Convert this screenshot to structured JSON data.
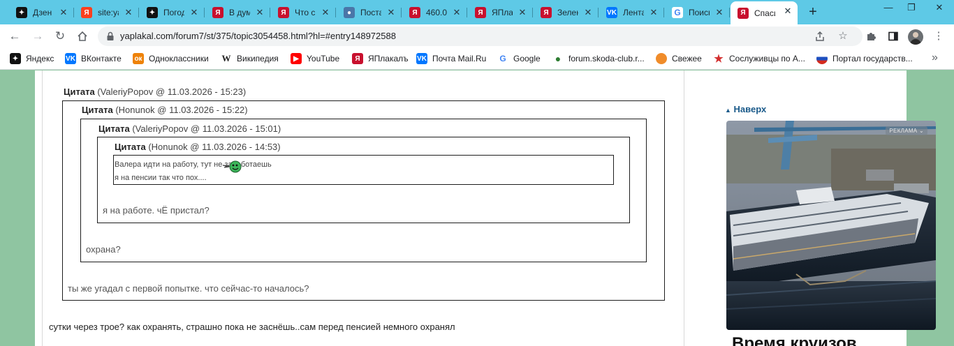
{
  "tabs": [
    {
      "title": "Дзен",
      "icon": "dzen-icon",
      "color": "#111111"
    },
    {
      "title": "site:ya",
      "icon": "yandex-icon",
      "color": "#fc3f1d"
    },
    {
      "title": "Погода",
      "icon": "dzen-icon",
      "color": "#111111"
    },
    {
      "title": "В дум",
      "icon": "yaplakal-icon",
      "color": "#c8102e"
    },
    {
      "title": "Что с",
      "icon": "yaplakal-icon",
      "color": "#c8102e"
    },
    {
      "title": "Поста",
      "icon": "site-icon",
      "color": "#4a76a8"
    },
    {
      "title": "460.0",
      "icon": "yaplakal-icon",
      "color": "#c8102e"
    },
    {
      "title": "ЯПлак",
      "icon": "yaplakal-icon",
      "color": "#c8102e"
    },
    {
      "title": "Зелен",
      "icon": "yaplakal-icon",
      "color": "#c8102e"
    },
    {
      "title": "Лента",
      "icon": "vk-icon",
      "color": "#0077ff"
    },
    {
      "title": "Поиск",
      "icon": "google-icon",
      "color": "#ffffff"
    },
    {
      "title": "Спаси",
      "icon": "yaplakal-icon",
      "color": "#c8102e",
      "active": true
    }
  ],
  "address_bar": {
    "url": "yaplakal.com/forum7/st/375/topic3054458.html?hl=#entry148972588"
  },
  "bookmarks": [
    {
      "label": "Яндекс",
      "icon": "dzen-icon",
      "color": "#111111"
    },
    {
      "label": "ВКонтакте",
      "icon": "vk-icon",
      "color": "#0077ff"
    },
    {
      "label": "Одноклассники",
      "icon": "ok-icon",
      "color": "#ee8208"
    },
    {
      "label": "Википедия",
      "icon": "wikipedia-icon",
      "color": "#ffffff"
    },
    {
      "label": "YouTube",
      "icon": "youtube-icon",
      "color": "#ff0000"
    },
    {
      "label": "ЯПлакалъ",
      "icon": "yaplakal-icon",
      "color": "#c8102e"
    },
    {
      "label": "Почта Mail.Ru",
      "icon": "vk-icon",
      "color": "#0077ff"
    },
    {
      "label": "Google",
      "icon": "google-icon",
      "color": "#ffffff"
    },
    {
      "label": "forum.skoda-club.r...",
      "icon": "skoda-icon",
      "color": "#ffffff"
    },
    {
      "label": "Свежее",
      "icon": "pikabu-icon",
      "color": "#f08c2a"
    },
    {
      "label": "Сослуживцы по А...",
      "icon": "star-icon",
      "color": "#ffffff"
    },
    {
      "label": "Портал государств...",
      "icon": "flag-icon",
      "color": "#ffffff"
    }
  ],
  "post": {
    "quotes": [
      {
        "label": "Цитата",
        "meta": "(ValeriyPopov @ 11.03.2026 - 15:23)",
        "text": "ты же угадал с первой попытке. что сейчас-то началось?"
      },
      {
        "label": "Цитата",
        "meta": "(Honunok @ 11.03.2026 - 15:22)",
        "text": "охрана?"
      },
      {
        "label": "Цитата",
        "meta": "(ValeriyPopov @ 11.03.2026 - 15:01)",
        "text": "я на работе. чЁ пристал?"
      },
      {
        "label": "Цитата",
        "meta": "(Honunok @ 11.03.2026 - 14:53)",
        "text_lines": [
          "Валера идти на работу, тут не заработаешь",
          "я на пенсии так что пох...."
        ]
      }
    ],
    "body": "сутки через трое? как охранять, страшно пока не заснёшь..сам перед пенсией немного охранял"
  },
  "sidebar": {
    "to_top": "Наверх",
    "ad_badge": "РЕКЛАМА",
    "ad_headline": "Время круизов"
  }
}
